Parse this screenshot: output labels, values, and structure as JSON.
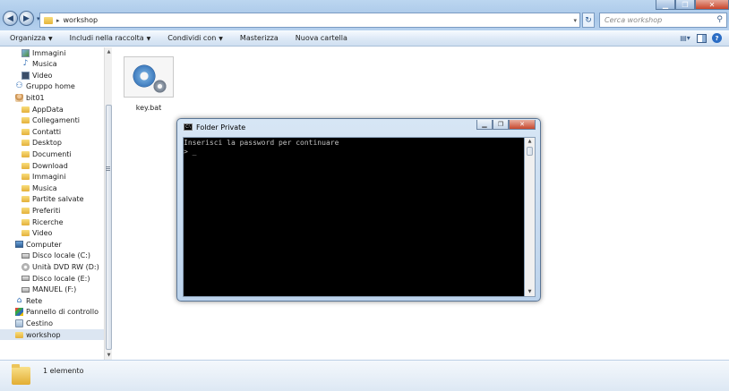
{
  "address": {
    "path": "workshop"
  },
  "search": {
    "placeholder": "Cerca workshop"
  },
  "toolbar": {
    "organize": "Organizza",
    "include_in_library": "Includi nella raccolta",
    "share_with": "Condividi con",
    "burn": "Masterizza",
    "new_folder": "Nuova cartella"
  },
  "nav": {
    "items": [
      {
        "label": "Immagini",
        "icon": "image-icon"
      },
      {
        "label": "Musica",
        "icon": "music-icon"
      },
      {
        "label": "Video",
        "icon": "video-icon"
      },
      {
        "label": "Gruppo home",
        "icon": "homegroup-icon"
      },
      {
        "label": "bit01",
        "icon": "user-icon"
      },
      {
        "label": "AppData",
        "icon": "folder-icon"
      },
      {
        "label": "Collegamenti",
        "icon": "folder-icon"
      },
      {
        "label": "Contatti",
        "icon": "folder-icon"
      },
      {
        "label": "Desktop",
        "icon": "folder-icon"
      },
      {
        "label": "Documenti",
        "icon": "folder-icon"
      },
      {
        "label": "Download",
        "icon": "folder-icon"
      },
      {
        "label": "Immagini",
        "icon": "folder-icon"
      },
      {
        "label": "Musica",
        "icon": "folder-icon"
      },
      {
        "label": "Partite salvate",
        "icon": "folder-icon"
      },
      {
        "label": "Preferiti",
        "icon": "folder-icon"
      },
      {
        "label": "Ricerche",
        "icon": "folder-icon"
      },
      {
        "label": "Video",
        "icon": "folder-icon"
      },
      {
        "label": "Computer",
        "icon": "computer-icon"
      },
      {
        "label": "Disco locale (C:)",
        "icon": "drive-icon"
      },
      {
        "label": "Unità DVD RW (D:)",
        "icon": "dvd-drive-icon"
      },
      {
        "label": "Disco locale (E:)",
        "icon": "drive-icon"
      },
      {
        "label": "MANUEL (F:)",
        "icon": "drive-icon"
      },
      {
        "label": "Rete",
        "icon": "network-icon"
      },
      {
        "label": "Pannello di controllo",
        "icon": "control-panel-icon"
      },
      {
        "label": "Cestino",
        "icon": "recycle-bin-icon"
      },
      {
        "label": "workshop",
        "icon": "folder-icon",
        "selected": true
      }
    ]
  },
  "files": [
    {
      "name": "key.bat",
      "icon": "batch-file-icon"
    }
  ],
  "status": {
    "count": "1 elemento"
  },
  "console": {
    "title": "Folder Private",
    "lines": [
      "Inserisci la password per continuare",
      "> _"
    ]
  }
}
